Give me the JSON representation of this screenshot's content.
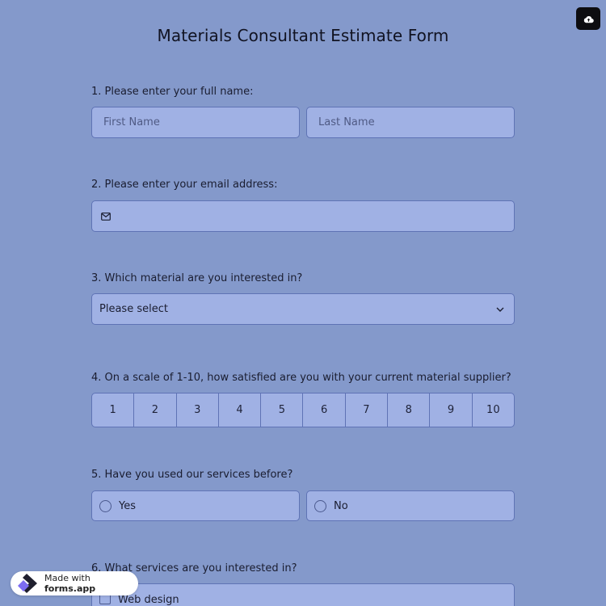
{
  "form": {
    "title": "Materials Consultant Estimate Form"
  },
  "toolbar": {
    "save_icon": "cloud-upload-icon"
  },
  "questions": {
    "q1": {
      "label": "1. Please enter your full name:",
      "first_placeholder": "First Name",
      "last_placeholder": "Last Name"
    },
    "q2": {
      "label": "2. Please enter your email address:",
      "icon": "envelope-icon",
      "value": ""
    },
    "q3": {
      "label": "3. Which material are you interested in?",
      "selected": "Please select",
      "icon": "chevron-down-icon"
    },
    "q4": {
      "label": "4. On a scale of 1-10, how satisfied are you with your current material supplier?",
      "options": [
        "1",
        "2",
        "3",
        "4",
        "5",
        "6",
        "7",
        "8",
        "9",
        "10"
      ]
    },
    "q5": {
      "label": "5. Have you used our services before?",
      "options": [
        "Yes",
        "No"
      ]
    },
    "q6": {
      "label": "6. What services are you interested in?",
      "options": [
        "Web design"
      ]
    }
  },
  "badge": {
    "prefix": "Made with",
    "brand": "forms.app",
    "icon": "forms-app-logo-icon"
  },
  "colors": {
    "background": "#8499cb",
    "field_fill": "#a0b1e4",
    "field_border": "#5f73b5",
    "save_button": "#0d0d10"
  }
}
